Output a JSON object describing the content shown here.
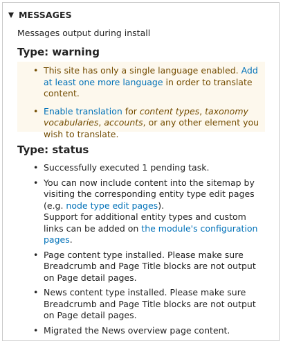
{
  "details": {
    "summary_label": "MESSAGES",
    "toggle_icon": "triangle-down-icon",
    "intro_text": "Messages output during install"
  },
  "warning": {
    "heading": "Type: warning",
    "background_color": "#fdf8ed",
    "text_color": "#734c00",
    "items": [
      {
        "text_before": "This site has only a single language enabled. ",
        "link_text": "Add at least one more language",
        "text_after": " in order to translate content."
      },
      {
        "link_text": "Enable translation",
        "text_for": " for ",
        "em1": "content types",
        "sep1": ", ",
        "em2": "taxonomy vocabularies",
        "sep2": ", ",
        "em3": "accounts",
        "text_after": ", or any other element you wish to translate."
      }
    ]
  },
  "status": {
    "heading": "Type: status",
    "items": [
      {
        "text": "Successfully executed 1 pending task."
      },
      {
        "text_before": "You can now include content into the sitemap by visiting the corresponding entity type edit pages (e.g. ",
        "link_text": "node type edit pages",
        "text_mid": ").",
        "text_support": "Support for additional entity types and custom links can be added on ",
        "link2_text": "the module's configuration pages",
        "text_after": "."
      },
      {
        "text": "Page content type installed. Please make sure Breadcrumb and Page Title blocks are not output on Page detail pages."
      },
      {
        "text": "News content type installed. Please make sure Breadcrumb and Page Title blocks are not output on Page detail pages."
      },
      {
        "text": "Migrated the News overview page content."
      }
    ]
  },
  "colors": {
    "link": "#0071b8",
    "border": "#c9c9c9"
  }
}
